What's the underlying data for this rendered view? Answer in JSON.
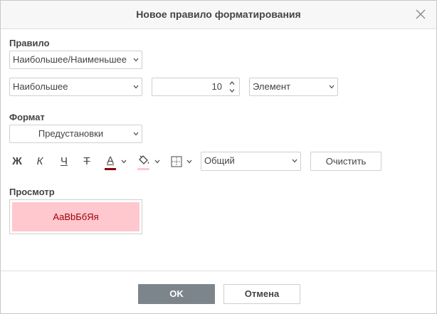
{
  "dialog": {
    "title": "Новое правило форматирования"
  },
  "rule": {
    "label": "Правило",
    "type_value": "Наибольшее/Наименьшее",
    "direction_value": "Наибольшее",
    "count_value": "10",
    "unit_value": "Элемент"
  },
  "format": {
    "label": "Формат",
    "preset_value": "Предустановки",
    "bold_glyph": "Ж",
    "italic_glyph": "К",
    "underline_glyph": "Ч",
    "strike_glyph": "Т",
    "font_color_glyph": "А",
    "font_color": "#8b0000",
    "fill_color": "#ffc7ce",
    "number_format_value": "Общий",
    "clear_label": "Очистить"
  },
  "preview": {
    "label": "Просмотр",
    "sample_text": "АаВbБбЯя",
    "bg_color": "#ffc7ce",
    "text_color": "#9c0006"
  },
  "footer": {
    "ok_label": "OK",
    "cancel_label": "Отмена"
  }
}
